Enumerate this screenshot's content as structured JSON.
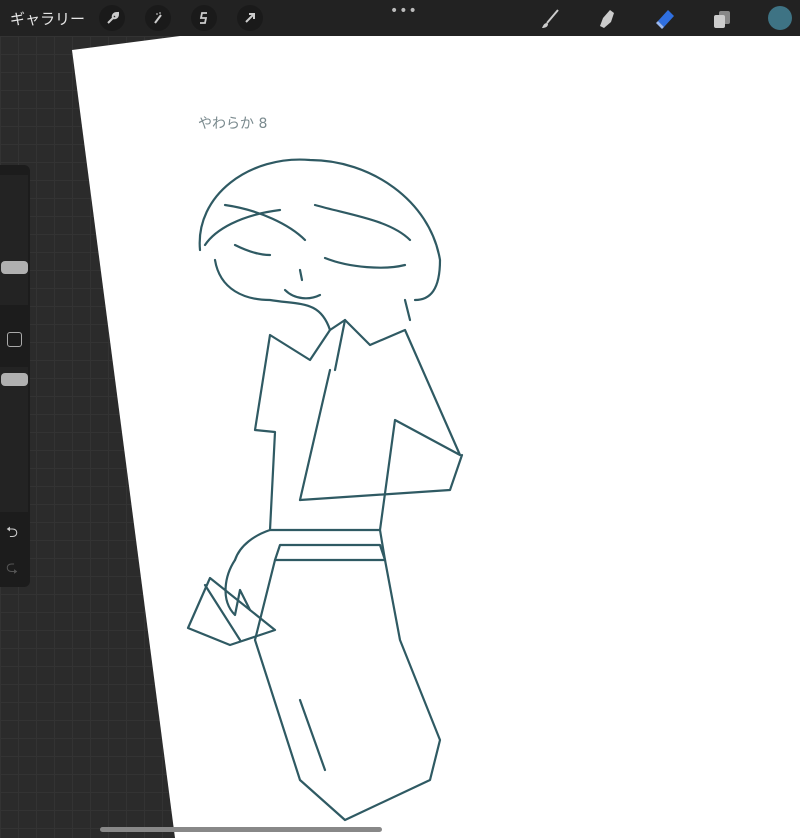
{
  "topbar": {
    "gallery_label": "ギャラリー",
    "tools_left": [
      "wrench-icon",
      "magic-wand-icon",
      "selection-icon",
      "transform-arrow-icon"
    ],
    "more_label": "•••",
    "tools_right": [
      "brush-icon",
      "smudge-icon",
      "eraser-icon",
      "layers-icon",
      "color-swatch"
    ]
  },
  "colors": {
    "active_tool": "#2f6fe0",
    "current_color": "#3e7384",
    "ink": "#2f5a63"
  },
  "sidebar": {
    "undo_label": "⮌",
    "redo_label": "⮎"
  },
  "canvas": {
    "handwritten_note": "やわらか 8"
  }
}
